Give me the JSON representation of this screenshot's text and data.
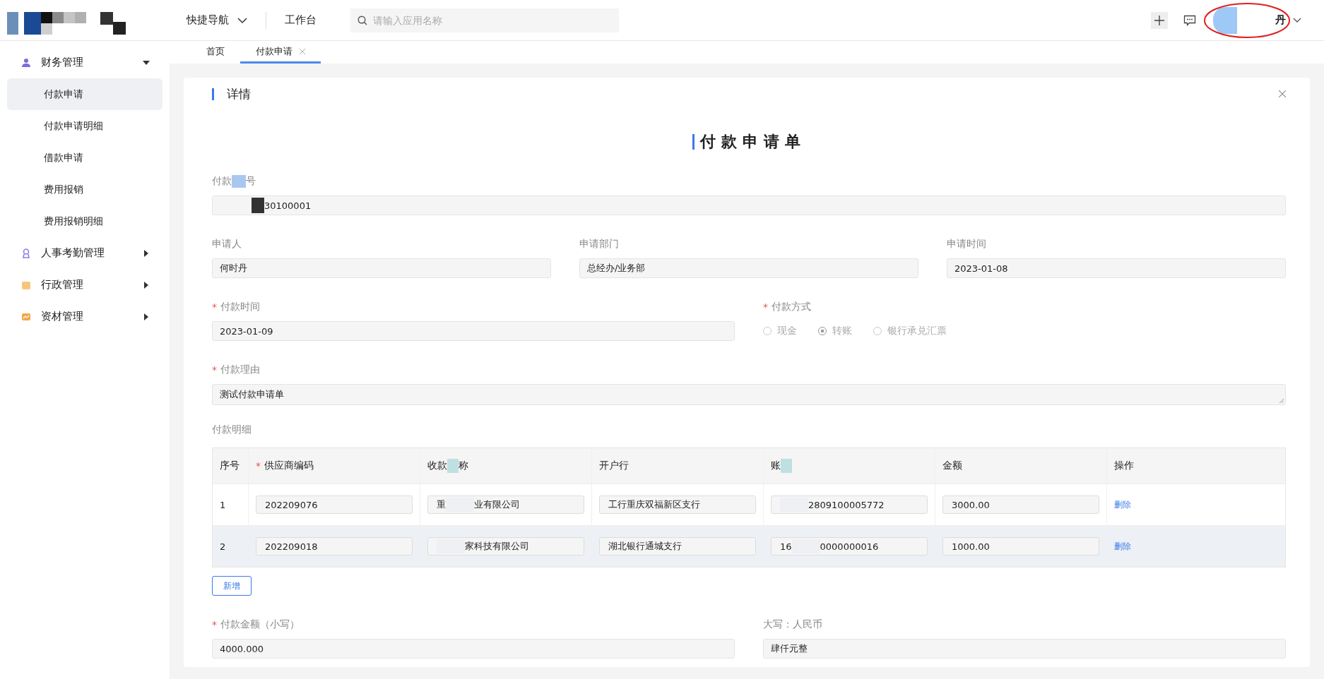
{
  "header": {
    "nav_menu": "快捷导航",
    "workbench": "工作台",
    "search": {
      "placeholder": "请输入应用名称"
    },
    "user": {
      "name": "丹"
    }
  },
  "sidebar": {
    "items": [
      {
        "label": "财务管理",
        "kind": "person",
        "expanded": true,
        "children": [
          {
            "label": "付款申请",
            "selected": true
          },
          {
            "label": "付款申请明细",
            "selected": false
          },
          {
            "label": "借款申请",
            "selected": false
          },
          {
            "label": "费用报销",
            "selected": false
          },
          {
            "label": "费用报销明细",
            "selected": false
          }
        ]
      },
      {
        "label": "人事考勤管理",
        "kind": "badge",
        "expanded": false
      },
      {
        "label": "行政管理",
        "kind": "folder",
        "expanded": false
      },
      {
        "label": "资材管理",
        "kind": "chart",
        "expanded": false
      }
    ]
  },
  "tabs": [
    {
      "label": "首页",
      "selected": false,
      "closable": false
    },
    {
      "label": "付款申请",
      "selected": true,
      "closable": true
    }
  ],
  "panel": {
    "required_mark": "*",
    "title": "详情",
    "form_title": "付款申请单",
    "payment_no": {
      "label": {
        "before": "付款",
        "after": "号"
      },
      "value": {
        "after": "30100001"
      }
    },
    "info_row": [
      {
        "label": "申请人",
        "value": "何时丹"
      },
      {
        "label": "申请部门",
        "value": "总经办/业务部"
      },
      {
        "label": "申请时间",
        "value": "2023-01-08"
      }
    ],
    "payment_date": {
      "label": "付款时间",
      "required": true,
      "value": "2023-01-09"
    },
    "payment_method": {
      "label": "付款方式",
      "required": true,
      "disabled": true,
      "options": [
        {
          "label": "现金",
          "selected": false
        },
        {
          "label": "转账",
          "selected": true
        },
        {
          "label": "银行承兑汇票",
          "selected": false
        }
      ]
    },
    "reason": {
      "label": "付款理由",
      "required": true,
      "value": "测试付款申请单"
    },
    "details": {
      "title": "付款明细",
      "columns": [
        {
          "text": "序号",
          "required": false
        },
        {
          "text": "供应商编码",
          "required": true
        },
        {
          "before": "收款",
          "after": "称",
          "required": false
        },
        {
          "text": "开户行",
          "required": false
        },
        {
          "before": "账",
          "required": false
        },
        {
          "text": "金额",
          "required": false
        },
        {
          "text": "操作",
          "required": false
        }
      ],
      "rows": [
        {
          "highlighted": false,
          "cells": [
            {
              "text": "1"
            },
            {
              "text": "202209076"
            },
            {
              "before": "重",
              "after": "业有限公司"
            },
            {
              "text": "工行重庆双福新区支行"
            },
            {
              "after": "2809100005772"
            },
            {
              "text": "3000.00"
            }
          ],
          "action": "删除"
        },
        {
          "highlighted": true,
          "cells": [
            {
              "text": "2"
            },
            {
              "text": "202209018"
            },
            {
              "after": "家科技有限公司"
            },
            {
              "text": "湖北银行通城支行"
            },
            {
              "before": "16",
              "after": "0000000016"
            },
            {
              "text": "1000.00"
            }
          ],
          "action": "删除"
        }
      ],
      "add_button": "新增"
    },
    "amount": {
      "label": "付款金额（小写）",
      "required": true,
      "value": "4000.000"
    },
    "amount_upper": {
      "label": "大写：人民币",
      "required": false,
      "value": "肆仟元整"
    }
  }
}
